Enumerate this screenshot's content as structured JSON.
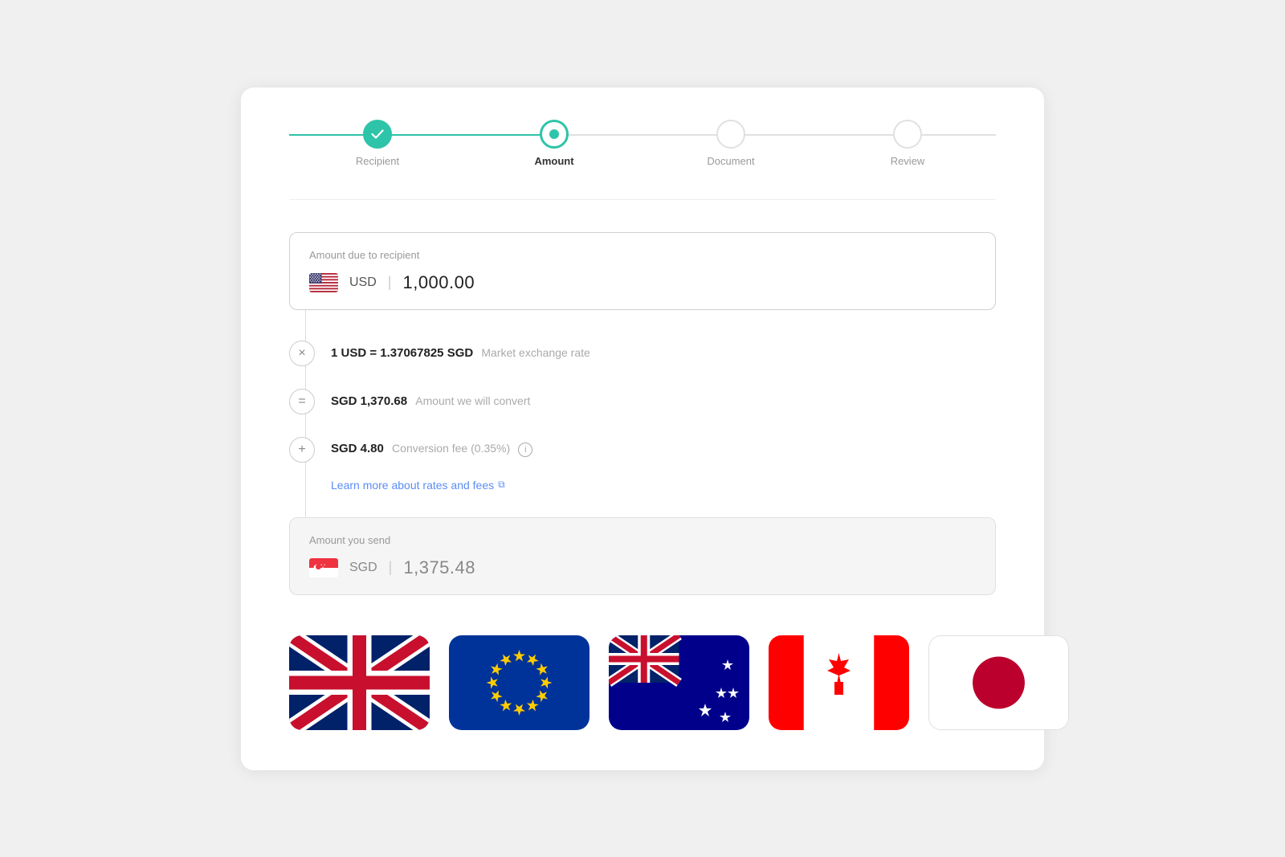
{
  "stepper": {
    "steps": [
      {
        "id": "recipient",
        "label": "Recipient",
        "state": "completed"
      },
      {
        "id": "amount",
        "label": "Amount",
        "state": "active"
      },
      {
        "id": "document",
        "label": "Document",
        "state": "inactive"
      },
      {
        "id": "review",
        "label": "Review",
        "state": "inactive"
      }
    ]
  },
  "amount_due": {
    "label": "Amount due to recipient",
    "currency_code": "USD",
    "amount": "1,000.00"
  },
  "exchange": {
    "rate_text": "1 USD = 1.37067825 SGD",
    "rate_label": "Market exchange rate",
    "converted_amount": "SGD 1,370.68",
    "converted_label": "Amount we will convert",
    "fee_amount": "SGD 4.80",
    "fee_label": "Conversion fee (0.35%)",
    "learn_more": "Learn more about rates and fees"
  },
  "amount_send": {
    "label": "Amount you send",
    "currency_code": "SGD",
    "amount": "1,375.48"
  },
  "operators": {
    "multiply": "×",
    "equals": "=",
    "plus": "+"
  }
}
